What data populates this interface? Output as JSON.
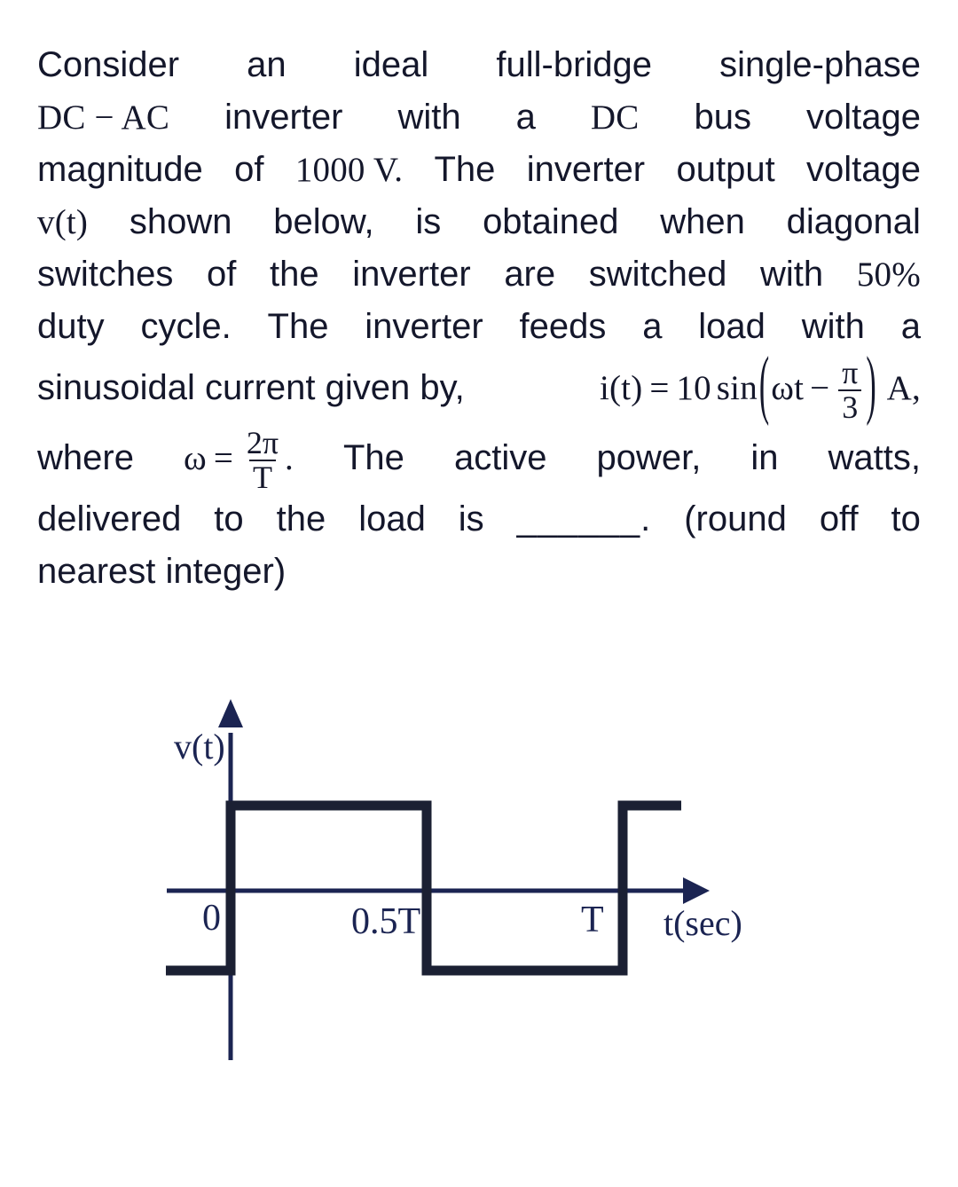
{
  "question": {
    "lines": [
      {
        "align": "just",
        "tokens": [
          {
            "t": "text",
            "v": "Consider"
          },
          {
            "t": "text",
            "v": "an"
          },
          {
            "t": "text",
            "v": "ideal"
          },
          {
            "t": "text",
            "v": "full-bridge"
          },
          {
            "t": "text",
            "v": "single-phase"
          }
        ]
      },
      {
        "align": "just",
        "tokens": [
          {
            "t": "math",
            "v": "DC − AC"
          },
          {
            "t": "text",
            "v": "inverter"
          },
          {
            "t": "text",
            "v": "with"
          },
          {
            "t": "text",
            "v": "a"
          },
          {
            "t": "math",
            "v": "DC"
          },
          {
            "t": "text",
            "v": "bus"
          },
          {
            "t": "text",
            "v": "voltage"
          }
        ]
      },
      {
        "align": "just",
        "tokens": [
          {
            "t": "text",
            "v": "magnitude"
          },
          {
            "t": "text",
            "v": "of"
          },
          {
            "t": "math",
            "v": "1000 V."
          },
          {
            "t": "text",
            "v": "The"
          },
          {
            "t": "text",
            "v": "inverter"
          },
          {
            "t": "text",
            "v": "output"
          },
          {
            "t": "text",
            "v": "voltage"
          }
        ]
      },
      {
        "align": "just",
        "tokens": [
          {
            "t": "math",
            "v": "v(t)"
          },
          {
            "t": "text",
            "v": "shown"
          },
          {
            "t": "text",
            "v": "below,"
          },
          {
            "t": "text",
            "v": "is"
          },
          {
            "t": "text",
            "v": "obtained"
          },
          {
            "t": "text",
            "v": "when"
          },
          {
            "t": "text",
            "v": "diagonal"
          }
        ]
      },
      {
        "align": "just",
        "tokens": [
          {
            "t": "text",
            "v": "switches"
          },
          {
            "t": "text",
            "v": "of"
          },
          {
            "t": "text",
            "v": "the"
          },
          {
            "t": "text",
            "v": "inverter"
          },
          {
            "t": "text",
            "v": "are"
          },
          {
            "t": "text",
            "v": "switched"
          },
          {
            "t": "text",
            "v": "with"
          },
          {
            "t": "math",
            "v": "50%"
          }
        ]
      },
      {
        "align": "just",
        "tokens": [
          {
            "t": "text",
            "v": "duty"
          },
          {
            "t": "text",
            "v": "cycle."
          },
          {
            "t": "text",
            "v": "The"
          },
          {
            "t": "text",
            "v": "inverter"
          },
          {
            "t": "text",
            "v": "feeds"
          },
          {
            "t": "text",
            "v": "a"
          },
          {
            "t": "text",
            "v": "load"
          },
          {
            "t": "text",
            "v": "with"
          },
          {
            "t": "text",
            "v": "a"
          }
        ]
      }
    ],
    "equation_current": {
      "lead": "sinusoidal current given by,",
      "lhs": "i(t)",
      "eq": "=",
      "amplitude": "10",
      "fn": "sin",
      "arg_first": "ωt",
      "arg_op": "−",
      "frac_num": "π",
      "frac_den": "3",
      "unit": "A,"
    },
    "equation_omega": {
      "lead": "where",
      "lhs": "ω",
      "eq": "=",
      "frac_num": "2π",
      "frac_den": "T",
      "period": ".",
      "tail_words": [
        "The",
        "active",
        "power,",
        "in",
        "watts,"
      ]
    },
    "final_line": {
      "words_before": [
        "delivered",
        "to",
        "the",
        "load",
        "is"
      ],
      "blank": "______.",
      "words_after": [
        "(round",
        "off",
        "to"
      ]
    },
    "closing_line": "nearest integer)"
  },
  "chart_data": {
    "type": "line",
    "title": "",
    "xlabel": "t(sec)",
    "ylabel": "v(t)",
    "description": "Ideal full-bridge single-phase inverter output voltage: a bipolar square wave of 50% duty cycle with period T, amplitude equal to the DC bus voltage magnitude.",
    "x_ticks": [
      "0",
      "0.5T",
      "T"
    ],
    "x_tick_values": [
      0,
      0.5,
      1.0
    ],
    "y_levels": {
      "high": 1,
      "low": -1
    },
    "series": [
      {
        "name": "v(t)",
        "points": [
          {
            "x": -0.19,
            "y": -1
          },
          {
            "x": 0.0,
            "y": -1
          },
          {
            "x": 0.0,
            "y": 1
          },
          {
            "x": 0.5,
            "y": 1
          },
          {
            "x": 0.5,
            "y": -1
          },
          {
            "x": 1.0,
            "y": -1
          },
          {
            "x": 1.0,
            "y": 1
          },
          {
            "x": 1.15,
            "y": 1
          }
        ]
      }
    ],
    "grid": false,
    "legend": false,
    "axis_arrows": true,
    "colors": {
      "waveform": "#1b2033",
      "axis": "#1b2452",
      "label": "#1b2452"
    }
  }
}
